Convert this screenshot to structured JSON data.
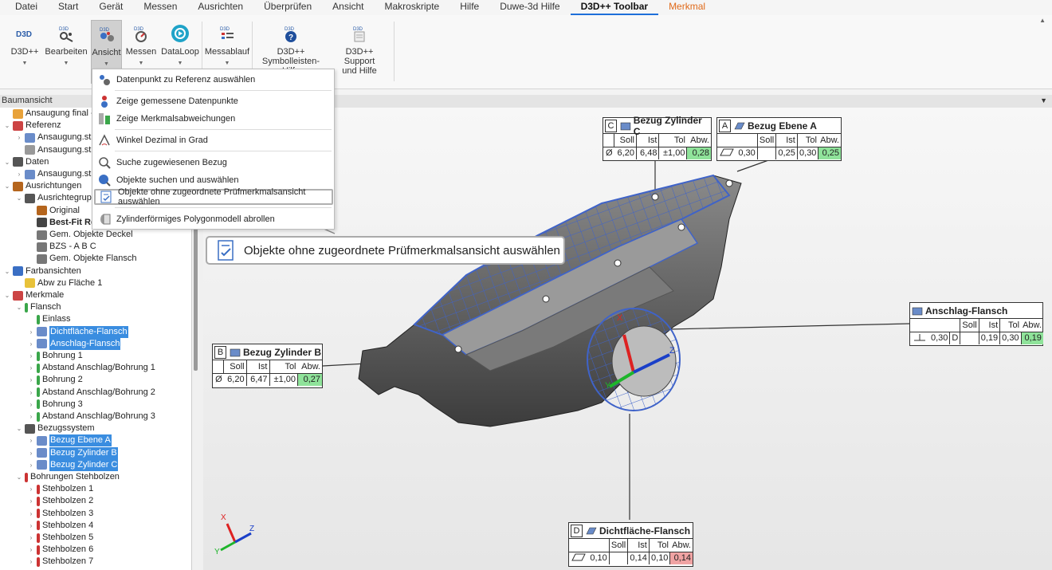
{
  "menu": {
    "items": [
      "Datei",
      "Start",
      "Gerät",
      "Messen",
      "Ausrichten",
      "Überprüfen",
      "Ansicht",
      "Makroskripte",
      "Hilfe",
      "Duwe-3d Hilfe"
    ],
    "active_tab": "D3D++ Toolbar",
    "context_tab": "Merkmal"
  },
  "ribbon": {
    "d3d": "D3D++",
    "bearbeiten": "Bearbeiten",
    "ansicht": "Ansicht",
    "messen": "Messen",
    "dataloop": "DataLoop",
    "messablauf": "Messablauf",
    "help_line1": "D3D++",
    "help_line2": "Symbolleisten-Hilfe",
    "support_line1": "D3D++ Support",
    "support_line2": "und Hilfe",
    "icon_text": "D3D"
  },
  "dropdown": {
    "items": [
      "Datenpunkt zu Referenz auswählen",
      "Zeige gemessene Datenpunkte",
      "Zeige Merkmalsabweichungen",
      "Winkel Dezimal in Grad",
      "Suche zugewiesenen Bezug",
      "Objekte suchen und auswählen",
      "Objekte ohne zugeordnete Prüfmerkmalsansicht auswählen",
      "Zylinderförmiges Polygonmodell abrollen"
    ]
  },
  "tooltip": {
    "text": "Objekte ohne zugeordnete Prüfmerkmalsansicht auswählen"
  },
  "tree": {
    "header": "Baumansicht",
    "rows": [
      "Ansaugung final - Tei",
      "Referenz",
      "Ansaugung.stp",
      "Ansaugung.stp",
      "Daten",
      "Ansaugung.stl",
      "Ausrichtungen",
      "Ausrichtegrup",
      "Original",
      "Best-Fit Re",
      "Gem. Objekte Deckel",
      "BZS - A B C",
      "Gem. Objekte Flansch",
      "Farbansichten",
      "Abw zu Fläche 1",
      "Merkmale",
      "Flansch",
      "Einlass",
      "Dichtfläche-Flansch",
      "Anschlag-Flansch",
      "Bohrung 1",
      "Abstand Anschlag/Bohrung 1",
      "Bohrung 2",
      "Abstand Anschlag/Bohrung 2",
      "Bohrung 3",
      "Abstand Anschlag/Bohrung 3",
      "Bezugssystem",
      "Bezug Ebene A",
      "Bezug Zylinder B",
      "Bezug Zylinder C",
      "Bohrungen Stehbolzen",
      "Stehbolzen 1",
      "Stehbolzen 2",
      "Stehbolzen 3",
      "Stehbolzen 4",
      "Stehbolzen 5",
      "Stehbolzen 6",
      "Stehbolzen 7"
    ]
  },
  "callouts": {
    "zylC": {
      "letter": "C",
      "title": "Bezug Zylinder C",
      "h": [
        "Soll",
        "Ist",
        "Tol",
        "Abw."
      ],
      "sym": "Ø",
      "soll": "6,20",
      "ist": "6,48",
      "tol": "±1,00",
      "abw": "0,28"
    },
    "ebeneA": {
      "letter": "A",
      "title": "Bezug Ebene A",
      "h": [
        "Soll",
        "Ist",
        "Tol",
        "Abw."
      ],
      "val0": "0,30",
      "ist": "0,25",
      "tol": "0,30",
      "abw": "0,25"
    },
    "anschlag": {
      "title": "Anschlag-Flansch",
      "h": [
        "Soll",
        "Ist",
        "Tol",
        "Abw."
      ],
      "val0": "0,30",
      "ref": "D",
      "ist": "0,19",
      "tol": "0,30",
      "abw": "0,19"
    },
    "zylB": {
      "letter": "B",
      "title": "Bezug Zylinder B",
      "h": [
        "Soll",
        "Ist",
        "Tol",
        "Abw."
      ],
      "sym": "Ø",
      "soll": "6,20",
      "ist": "6,47",
      "tol": "±1,00",
      "abw": "0,27"
    },
    "dicht": {
      "letter": "D",
      "title": "Dichtfläche-Flansch",
      "h": [
        "Soll",
        "Ist",
        "Tol",
        "Abw."
      ],
      "val0": "0,10",
      "ist": "0,14",
      "tol": "0,10",
      "abw": "0,14"
    }
  },
  "axes": {
    "x": "X",
    "y": "Y",
    "z": "Z"
  },
  "colors": {
    "accent": "#1e6fd9",
    "context_tab": "#e06a1a",
    "selection": "#3a8de0",
    "in_tol": "#8fe39a",
    "out_tol": "#f0a3a3",
    "mesh": "#3f63c9"
  }
}
